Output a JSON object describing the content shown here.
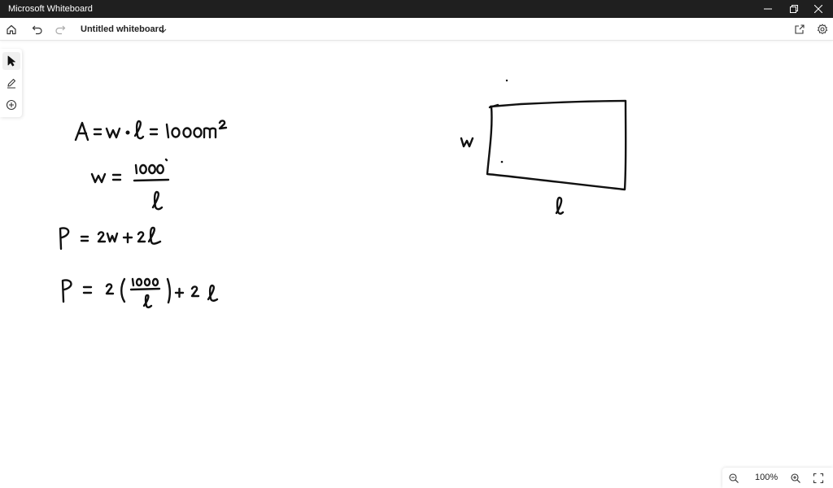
{
  "window": {
    "app_title": "Microsoft Whiteboard",
    "controls": [
      "minimize",
      "restore",
      "close"
    ]
  },
  "toolbar": {
    "document_title": "Untitled whiteboard",
    "icons": {
      "home": "home-icon",
      "undo": "undo-icon",
      "redo": "redo-icon",
      "title_menu": "chevron-down-icon",
      "share": "share-icon",
      "settings": "gear-icon"
    }
  },
  "tool_rail": {
    "tools": [
      "select-tool",
      "pen-tool",
      "add-tool"
    ],
    "active": "select-tool"
  },
  "zoom": {
    "level": "100%",
    "icons": {
      "out": "zoom-out-icon",
      "in": "zoom-in-icon",
      "fit": "fit-to-screen-icon"
    }
  },
  "colors": {
    "titlebar_bg": "#1f1f1f",
    "ink": "#111111",
    "canvas_bg": "#ffffff"
  }
}
